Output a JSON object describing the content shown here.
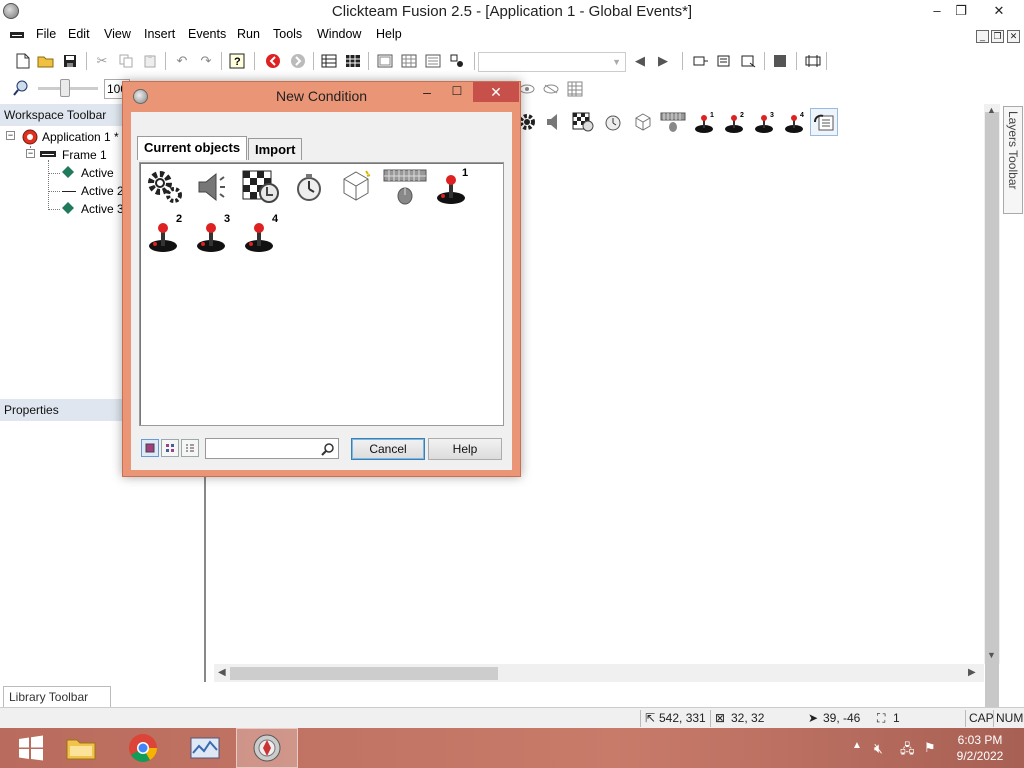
{
  "window": {
    "title": "Clickteam Fusion 2.5 - [Application 1 - Global Events*]",
    "controls": {
      "minimize": "–",
      "restore": "❐",
      "close": "✕"
    }
  },
  "menu": {
    "items": [
      "File",
      "Edit",
      "View",
      "Insert",
      "Events",
      "Run",
      "Tools",
      "Window",
      "Help"
    ],
    "mdi_controls": [
      "_",
      "❐",
      "✕"
    ]
  },
  "toolbar2": {
    "zoom_value": "100"
  },
  "workspace": {
    "title": "Workspace Toolbar",
    "tree": {
      "application": "Application 1 *",
      "frame": "Frame 1",
      "objects": [
        "Active",
        "Active 2",
        "Active 3"
      ]
    }
  },
  "properties": {
    "title": "Properties"
  },
  "layers": {
    "label": "Layers Toolbar"
  },
  "library": {
    "label": "Library Toolbar"
  },
  "status": {
    "position": "542, 331",
    "size": "32, 32",
    "mouse": "39, -46",
    "layer": "1",
    "caps": "CAP",
    "num": "NUM"
  },
  "dialog": {
    "title": "New Condition",
    "tabs": [
      "Current objects",
      "Import"
    ],
    "objects": [
      {
        "icon": "gear-icon",
        "badge": ""
      },
      {
        "icon": "speaker-icon",
        "badge": ""
      },
      {
        "icon": "storyboard-icon",
        "badge": ""
      },
      {
        "icon": "timer-icon",
        "badge": ""
      },
      {
        "icon": "new-objects-icon",
        "badge": ""
      },
      {
        "icon": "keyboard-mouse-icon",
        "badge": ""
      },
      {
        "icon": "joystick-icon",
        "badge": "1"
      },
      {
        "icon": "joystick-icon",
        "badge": "2"
      },
      {
        "icon": "joystick-icon",
        "badge": "3"
      },
      {
        "icon": "joystick-icon",
        "badge": "4"
      }
    ],
    "search": {
      "value": "",
      "placeholder": ""
    },
    "buttons": {
      "cancel": "Cancel",
      "help": "Help"
    }
  },
  "taskbar": {
    "time": "6:03 PM",
    "date": "9/2/2022"
  },
  "colors": {
    "dialog_frame": "#eb9577",
    "close_button": "#c7504a",
    "taskbar": "#c97b6a",
    "panel_header": "#dfe6ef"
  }
}
